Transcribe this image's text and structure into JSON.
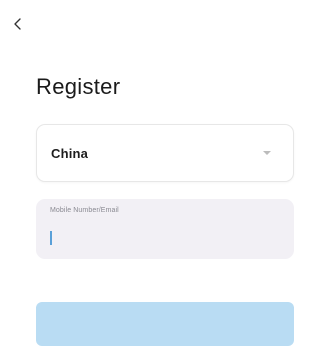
{
  "header": {
    "back_icon": "chevron-left-icon"
  },
  "page": {
    "title": "Register"
  },
  "country_select": {
    "value": "China",
    "dropdown_icon": "caret-down-icon"
  },
  "account_field": {
    "label": "Mobile Number/Email",
    "value": ""
  },
  "submit": {
    "label": "",
    "enabled": false
  },
  "colors": {
    "title_text": "#1b1b1b",
    "input_background": "#f2f0f5",
    "cursor": "#5aa0d8",
    "button_disabled": "#b9dcf3"
  }
}
